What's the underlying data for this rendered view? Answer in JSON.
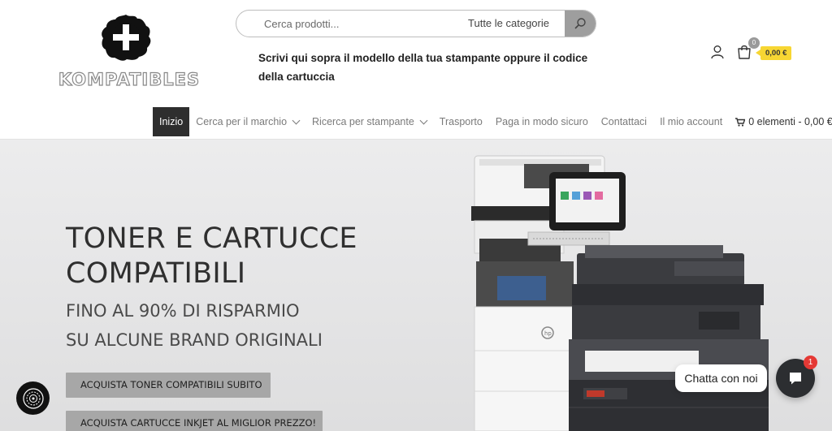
{
  "header": {
    "logo_text": "KOMPATIBLES",
    "search": {
      "placeholder": "Cerca prodotti...",
      "category_label": "Tutte le categorie"
    },
    "helper_text": "Scrivi qui sopra il modello della tua stampante oppure il codice della cartuccia",
    "cart": {
      "count": "0",
      "total": "0,00 €"
    }
  },
  "nav": {
    "items": [
      {
        "label": "Inizio"
      },
      {
        "label": "Cerca per il marchio"
      },
      {
        "label": "Ricerca per stampante"
      },
      {
        "label": "Trasporto"
      },
      {
        "label": "Paga in modo sicuro"
      },
      {
        "label": "Contattaci"
      },
      {
        "label": "Il mio account"
      },
      {
        "label": "0 elementi - 0,00 €"
      }
    ]
  },
  "hero": {
    "title": "TONER E CARTUCCE COMPATIBILI",
    "subtitle_1": "FINO AL 90% DI RISPARMIO",
    "subtitle_2": "SU ALCUNE BRAND ORIGINALI",
    "button_1": "ACQUISTA TONER COMPATIBILI SUBITO",
    "button_2": "ACQUISTA CARTUCCE INKJET AL MIGLIOR PREZZO!"
  },
  "chat": {
    "label": "Chatta con noi",
    "badge": "1"
  },
  "colors": {
    "accent_yellow": "#f7d633",
    "nav_active_bg": "#2e2e2e",
    "button_bg": "#a7a7a7",
    "chat_bg": "#2c2e31",
    "badge_red": "#e53935"
  }
}
